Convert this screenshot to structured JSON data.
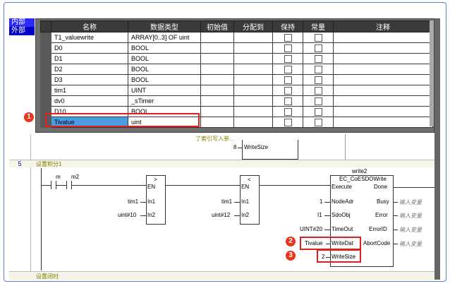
{
  "scope_tabs": [
    "内部",
    "外部"
  ],
  "columns": [
    "名称",
    "数据类型",
    "初始值",
    "分配到",
    "保持",
    "常量",
    "注释"
  ],
  "rows": [
    {
      "name": "T1_valuewrite",
      "type": "ARRAY[0..3] OF uint"
    },
    {
      "name": "D0",
      "type": "BOOL"
    },
    {
      "name": "D1",
      "type": "BOOL"
    },
    {
      "name": "D2",
      "type": "BOOL"
    },
    {
      "name": "D3",
      "type": "BOOL"
    },
    {
      "name": "tim1",
      "type": "UINT"
    },
    {
      "name": "dv0",
      "type": "_sTimer"
    },
    {
      "name": "D10",
      "type": "BOOL"
    },
    {
      "name": "Tivalue",
      "type": "uint"
    }
  ],
  "badges": [
    "1",
    "2",
    "3"
  ],
  "prev_rung": {
    "comment": "了索引写入参…",
    "pin_value": "8",
    "pin_label": "WriteSize"
  },
  "rung": {
    "number": "5",
    "comment": "设置积分1",
    "contact1": "m",
    "contact2": "m2",
    "gt_block": {
      "op": ">",
      "en": "EN",
      "in1_val": "tim1",
      "in1": "In1",
      "in2_val": "uint#10",
      "in2": "In2"
    },
    "lt_block": {
      "op": "<",
      "en": "EN",
      "in1_val": "tim1",
      "in1": "In1",
      "in2_val": "uint#12",
      "in2": "In2"
    },
    "fb": {
      "instance": "write2",
      "type": "EC_CoESDOWrite",
      "in_pins": [
        {
          "val": "",
          "pin": "Execute"
        },
        {
          "val": "1",
          "pin": "NodeAdr"
        },
        {
          "val": "I1",
          "pin": "SdoObj"
        },
        {
          "val": "UINT#20",
          "pin": "TimeOut"
        },
        {
          "val": "Tivalue",
          "pin": "WriteDat"
        },
        {
          "val": "2",
          "pin": "WriteSize"
        }
      ],
      "out_pins": [
        {
          "pin": "Done",
          "val": ""
        },
        {
          "pin": "Busy",
          "val": "输入变量"
        },
        {
          "pin": "Error",
          "val": "输入变量"
        },
        {
          "pin": "ErrorID",
          "val": "输入变量"
        },
        {
          "pin": "AbortCode",
          "val": "输入变量"
        }
      ]
    }
  },
  "next_rung_comment": "设置闭时"
}
